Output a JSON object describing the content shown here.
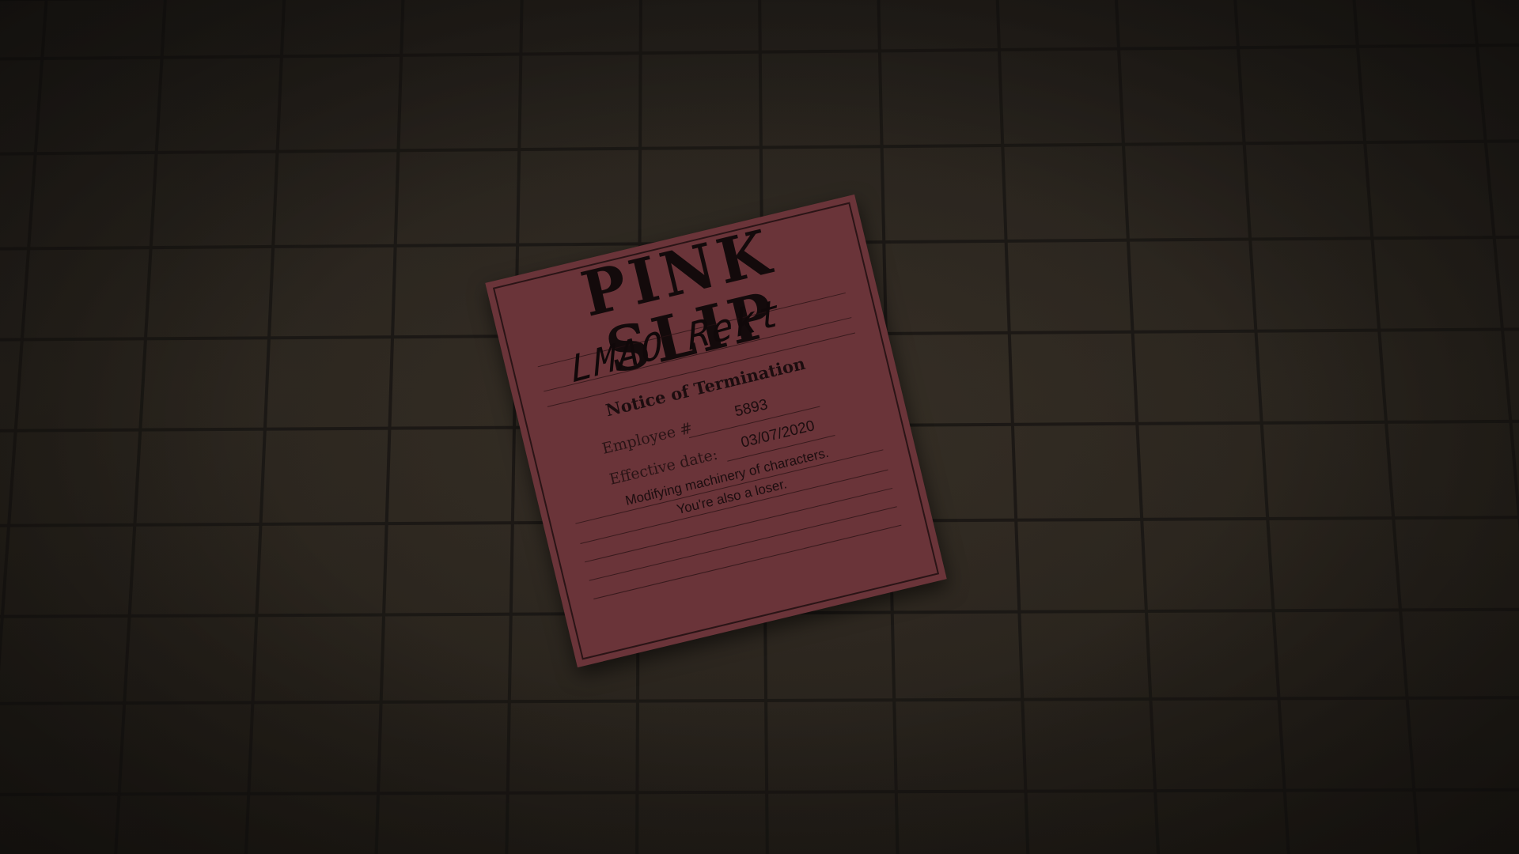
{
  "scene": {
    "floor_color": "#2a251f",
    "grout_color": "#1a1714",
    "slip_color": "#6a3439"
  },
  "slip": {
    "title": "PINK SLIP",
    "handwriting": "LMAO Rekt",
    "heading": "Notice of Termination",
    "employee_label": "Employee #",
    "employee_value": "5893",
    "date_label": "Effective date:",
    "date_value": "03/07/2020",
    "reason_line1": "Modifying machinery of characters.",
    "reason_line2": "You're also a loser."
  }
}
